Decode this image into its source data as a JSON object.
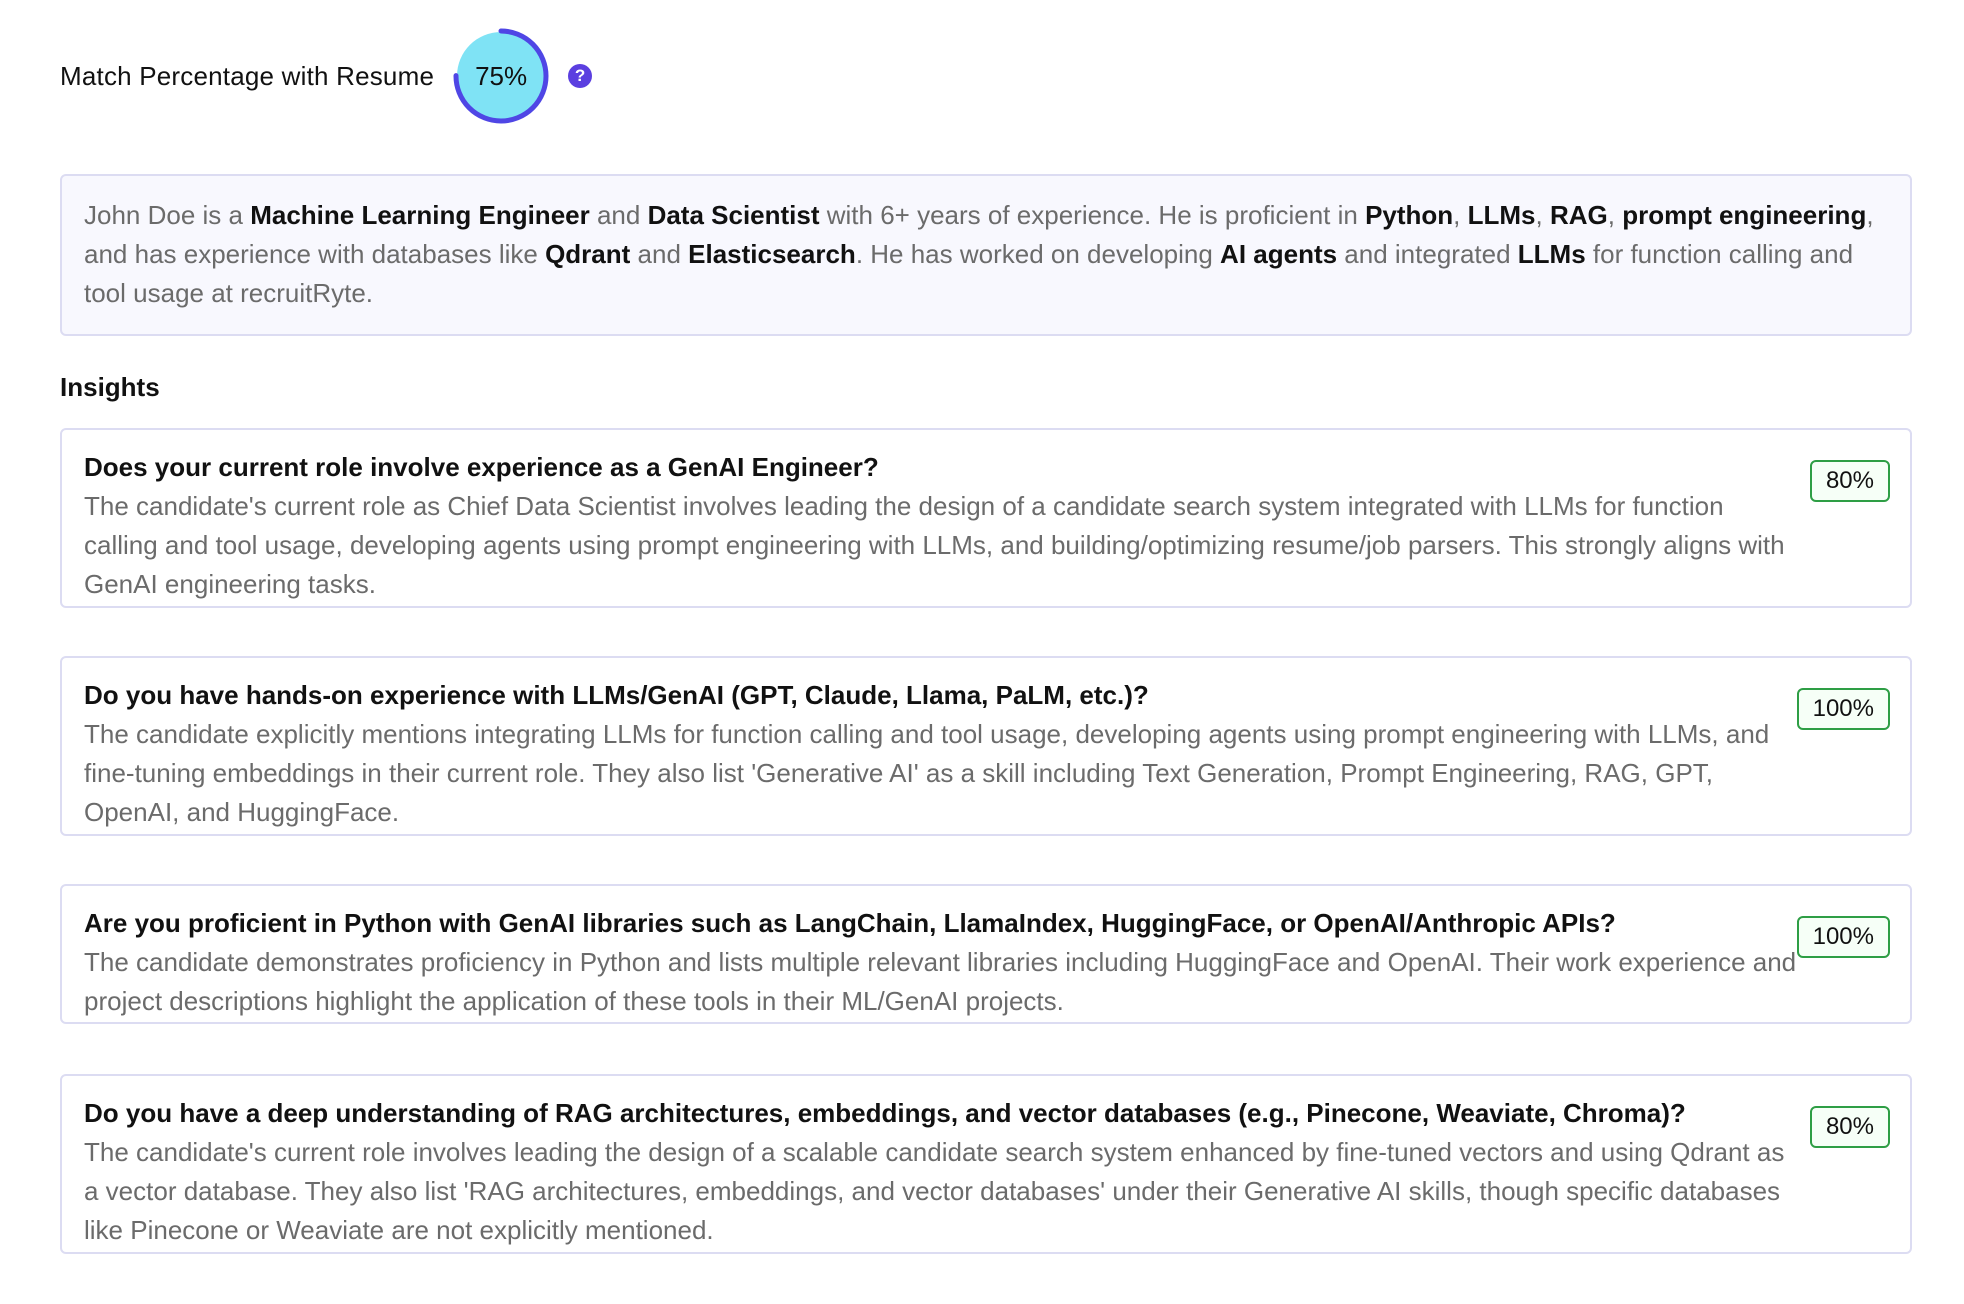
{
  "match": {
    "label": "Match Percentage with Resume",
    "value_text": "75%",
    "percent": 75,
    "help_icon": "question-circle-icon"
  },
  "summary": [
    {
      "t": "John Doe is a ",
      "b": false
    },
    {
      "t": "Machine Learning Engineer",
      "b": true
    },
    {
      "t": " and ",
      "b": false
    },
    {
      "t": "Data Scientist",
      "b": true
    },
    {
      "t": " with 6+ years of experience. He is proficient in ",
      "b": false
    },
    {
      "t": "Python",
      "b": true
    },
    {
      "t": ", ",
      "b": false
    },
    {
      "t": "LLMs",
      "b": true
    },
    {
      "t": ", ",
      "b": false
    },
    {
      "t": "RAG",
      "b": true
    },
    {
      "t": ", ",
      "b": false
    },
    {
      "t": "prompt engineering",
      "b": true
    },
    {
      "t": ", and has experience with databases like ",
      "b": false
    },
    {
      "t": "Qdrant",
      "b": true
    },
    {
      "t": " and ",
      "b": false
    },
    {
      "t": "Elasticsearch",
      "b": true
    },
    {
      "t": ". He has worked on developing ",
      "b": false
    },
    {
      "t": "AI agents",
      "b": true
    },
    {
      "t": " and integrated ",
      "b": false
    },
    {
      "t": "LLMs",
      "b": true
    },
    {
      "t": " for function calling and tool usage at recruitRyte.",
      "b": false
    }
  ],
  "insights": {
    "title": "Insights",
    "items": [
      {
        "question": "Does your current role involve experience as a GenAI Engineer?",
        "answer": "The candidate's current role as Chief Data Scientist involves leading the design of a candidate search system integrated with LLMs for function calling and tool usage, developing agents using prompt engineering with LLMs, and building/optimizing resume/job parsers. This strongly aligns with GenAI engineering tasks.",
        "score": "80%"
      },
      {
        "question": "Do you have hands-on experience with LLMs/GenAI (GPT, Claude, Llama, PaLM, etc.)?",
        "answer": "The candidate explicitly mentions integrating LLMs for function calling and tool usage, developing agents using prompt engineering with LLMs, and fine-tuning embeddings in their current role. They also list 'Generative AI' as a skill including Text Generation, Prompt Engineering, RAG, GPT, OpenAI, and HuggingFace.",
        "score": "100%"
      },
      {
        "question": "Are you proficient in Python with GenAI libraries such as LangChain, LlamaIndex, HuggingFace, or OpenAI/Anthropic APIs?",
        "answer": "The candidate demonstrates proficiency in Python and lists multiple relevant libraries including HuggingFace and OpenAI. Their work experience and project descriptions highlight the application of these tools in their ML/GenAI projects.",
        "score": "100%"
      },
      {
        "question": "Do you have a deep understanding of RAG architectures, embeddings, and vector databases (e.g., Pinecone, Weaviate, Chroma)?",
        "answer": "The candidate's current role involves leading the design of a scalable candidate search system enhanced by fine-tuned vectors and using Qdrant as a vector database. They also list 'RAG architectures, embeddings, and vector databases' under their Generative AI skills, though specific databases like Pinecone or Weaviate are not explicitly mentioned.",
        "score": "80%"
      }
    ]
  },
  "colors": {
    "ring_fill": "#7fe3f5",
    "ring_track": "#4f46e5",
    "badge_border": "#2e9e45",
    "card_border": "#dcdcf2"
  }
}
